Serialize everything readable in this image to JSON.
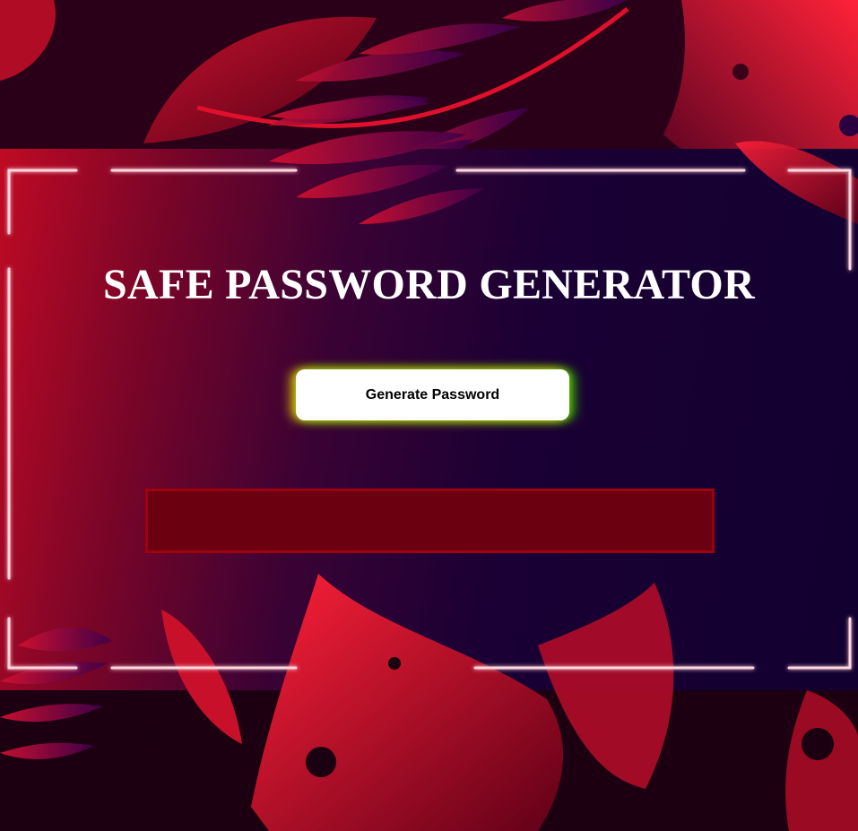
{
  "header": {
    "title": "SAFE PASSWORD GENERATOR"
  },
  "actions": {
    "generate_label": "Generate Password"
  },
  "output": {
    "password": ""
  },
  "colors": {
    "neon_frame": "#ff3048",
    "panel_dark": "#120030",
    "leaf": "#d81030",
    "output_bg": "#6a0010",
    "output_border": "#a0000e"
  }
}
